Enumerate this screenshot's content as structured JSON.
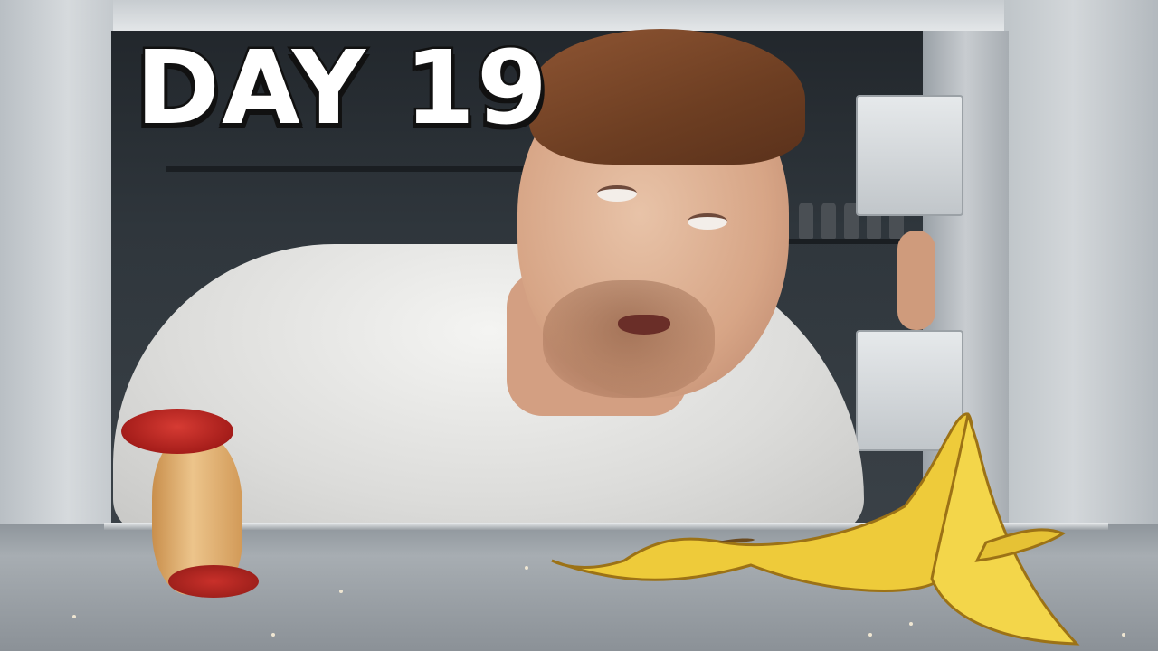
{
  "overlay": {
    "title": "DAY 19"
  },
  "colors": {
    "title_fill": "#ffffff",
    "title_outline": "#111111",
    "fridge_interior": "#c3c8cc",
    "apple_red": "#c0302a",
    "banana_yellow": "#f0cf3c"
  }
}
